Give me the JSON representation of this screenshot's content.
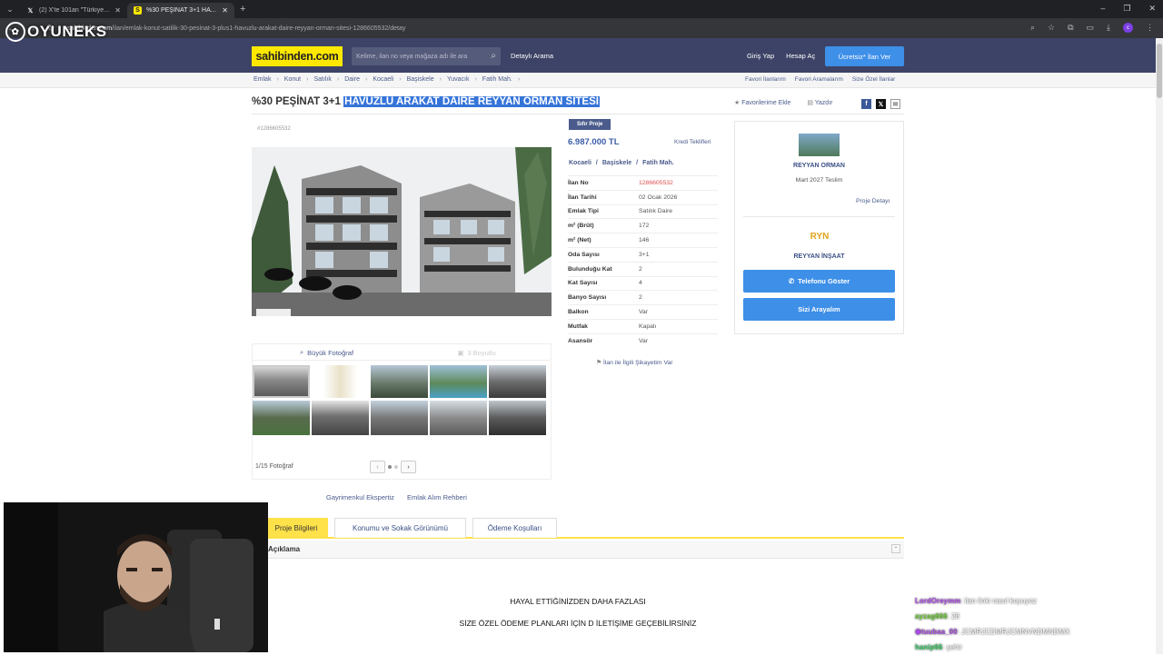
{
  "browser": {
    "tabs": [
      {
        "label": "(2) X'te 101an \"Türkiye'yi ziyare",
        "icon": "x-logo-icon",
        "active": false
      },
      {
        "label": "%30 PEŞİNAT 3+1 HAVUZLU AI",
        "icon": "sahibinden-favicon",
        "active": true
      }
    ],
    "url_domain": "sahibinden.com",
    "url_path": "/ilan/emlak-konut-satilik-30-pesinat-3-plus1-havuzlu-arakat-daire-reyyan-orman-sitesi-1286605532/detay"
  },
  "overlay": {
    "watermark": "OYUNEKS"
  },
  "header": {
    "logo": "sahibinden.com",
    "search_placeholder": "Kelime, ilan no veya mağaza adı ile ara",
    "detailed_search": "Detaylı Arama",
    "login": "Giriş Yap",
    "register": "Hesap Aç",
    "post_ad": "Ücretsiz* İlan Ver"
  },
  "breadcrumb": [
    "Emlak",
    "Konut",
    "Satılık",
    "Daire",
    "Kocaeli",
    "Başiskele",
    "Yuvacık",
    "Fatih Mah."
  ],
  "breadcrumb_right": [
    "Favori İlanlarım",
    "Favori Aramalarım",
    "Size Özel İlanlar"
  ],
  "listing": {
    "title_plain": "%30 PEŞİNAT 3+1 ",
    "title_selected": "HAVUZLU ARAKAT DAİRE REYYAN ORMAN SİTESİ",
    "add_favorite": "Favorilerime Ekle",
    "print": "Yazdır",
    "ad_id": "#1286605532",
    "badge": "Sıfır Proje",
    "price": "6.987.000 TL",
    "credit_offers": "Kredi Teklifleri",
    "location": [
      "Kocaeli",
      "Başiskele",
      "Fatih Mah."
    ],
    "location_sep": "/",
    "specs": [
      {
        "key": "İlan No",
        "value": "1286605532"
      },
      {
        "key": "İlan Tarihi",
        "value": "02 Ocak 2026"
      },
      {
        "key": "Emlak Tipi",
        "value": "Satılık Daire"
      },
      {
        "key": "m² (Brüt)",
        "value": "172"
      },
      {
        "key": "m² (Net)",
        "value": "146"
      },
      {
        "key": "Oda Sayısı",
        "value": "3+1"
      },
      {
        "key": "Bulunduğu Kat",
        "value": "2"
      },
      {
        "key": "Kat Sayısı",
        "value": "4"
      },
      {
        "key": "Banyo Sayısı",
        "value": "2"
      },
      {
        "key": "Balkon",
        "value": "Var"
      },
      {
        "key": "Mutfak",
        "value": "Kapalı"
      },
      {
        "key": "Asansör",
        "value": "Var"
      }
    ],
    "complaint": "İlan ile İlgili Şikayetim Var"
  },
  "gallery": {
    "big_photo": "Büyük Fotoğraf",
    "three_d": "3 Boyutlu",
    "counter": "1/15 Fotoğraf",
    "thumbnail_count": 10
  },
  "below_gallery_links": [
    "Gayrimenkul Ekspertiz",
    "Emlak Alım Rehberi"
  ],
  "project": {
    "name": "REYYAN ORMAN",
    "delivery": "Mart 2027 Teslim",
    "detail_link": "Proje Detayı",
    "firm_logo": "RYN",
    "firm": "REYYAN İNŞAAT",
    "phone_button": "Telefonu Göster",
    "call_me_button": "Sizi Arayalım"
  },
  "detail_tabs": [
    "Proje Bilgileri",
    "Konumu ve Sokak Görünümü",
    "Ödeme Koşulları"
  ],
  "description": {
    "header": "Açıklama",
    "line1": "HAYAL ETTİĞİNİZDEN DAHA FAZLASI",
    "line2": "SİZE ÖZEL ÖDEME PLANLARI İÇİN D İLETİŞİME GEÇEBİLİRSİNİZ"
  },
  "chat": [
    {
      "user": "LordOreymm",
      "text": ": ilan linki nasıl koyuyoz",
      "color": "#b44cf0"
    },
    {
      "user": "ayzag666",
      "text": ": 28",
      "color": "#6fcf3a"
    },
    {
      "user": "tuubaa_00",
      "text": ": JCMRJCDMRJCMNVNDMNDMX",
      "color": "#a64ce0"
    },
    {
      "user": "hanip66",
      "text": ": şehir",
      "color": "#3ccf6a"
    }
  ],
  "colors": {
    "header_bg": "#3d4366",
    "logo_yellow": "#ffe800",
    "accent_blue": "#3d8fe8",
    "tab_yellow": "#ffe14a",
    "selection_blue": "#3574d8"
  }
}
